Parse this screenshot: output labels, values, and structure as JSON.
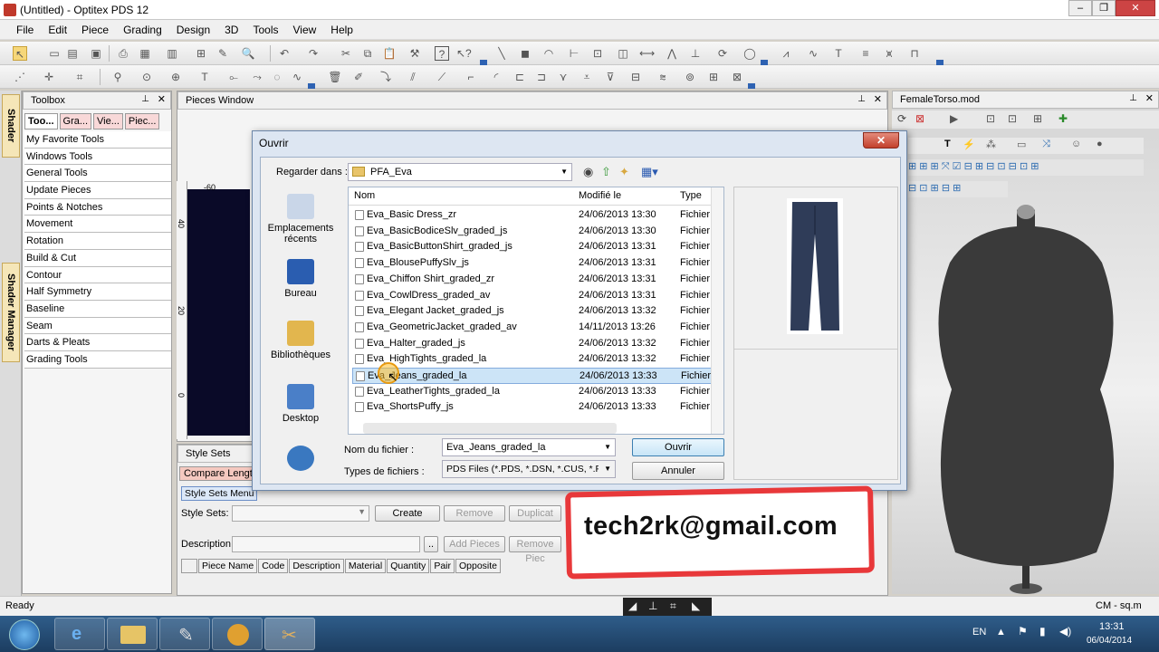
{
  "window": {
    "title": "(Untitled) - Optitex PDS 12",
    "controls": [
      "–",
      "❐",
      "✕"
    ]
  },
  "menu": [
    "File",
    "Edit",
    "Piece",
    "Grading",
    "Design",
    "3D",
    "Tools",
    "View",
    "Help"
  ],
  "side_tabs": [
    "Shader",
    "Shader Manager"
  ],
  "toolbox": {
    "title": "Toolbox",
    "pin": "📌",
    "close": "✕",
    "tabs": [
      "Too...",
      "Gra...",
      "Vie...",
      "Piec..."
    ],
    "items": [
      "My Favorite Tools",
      "Windows Tools",
      "General Tools",
      "Update Pieces",
      "Points & Notches",
      "Movement",
      "Rotation",
      "Build & Cut",
      "Contour",
      "Half Symmetry",
      "Baseline",
      "Seam",
      "Darts & Pleats",
      "Grading Tools"
    ]
  },
  "pieces_window": {
    "title": "Pieces Window",
    "ruler_ticks": [
      "-60",
      "40",
      "20",
      "0"
    ]
  },
  "model_window": {
    "title": "FemaleTorso.mod"
  },
  "style_sets": {
    "title": "Style Sets",
    "compare_tab": "Compare Lengt",
    "menu_button": "Style Sets Menu",
    "style_sets_label": "Style Sets:",
    "description_label": "Description:",
    "create": "Create",
    "remove": "Remove",
    "duplicate": "Duplicat",
    "add_pieces": "Add Pieces",
    "remove_pieces": "Remove Piec",
    "columns": [
      "Piece Name",
      "Code",
      "Description",
      "Material",
      "Quantity",
      "Pair",
      "Opposite"
    ]
  },
  "dialog": {
    "title": "Ouvrir",
    "look_in_label": "Regarder dans :",
    "look_in_value": "PFA_Eva",
    "places": [
      "Emplacements récents",
      "Bureau",
      "Bibliothèques",
      "Desktop"
    ],
    "columns": [
      "Nom",
      "Modifié le",
      "Type"
    ],
    "files": [
      {
        "name": "Eva_Basic Dress_zr",
        "date": "24/06/2013 13:30",
        "type": "Fichier P"
      },
      {
        "name": "Eva_BasicBodiceSlv_graded_js",
        "date": "24/06/2013 13:30",
        "type": "Fichier P"
      },
      {
        "name": "Eva_BasicButtonShirt_graded_js",
        "date": "24/06/2013 13:31",
        "type": "Fichier P"
      },
      {
        "name": "Eva_BlousePuffySlv_js",
        "date": "24/06/2013 13:31",
        "type": "Fichier P"
      },
      {
        "name": "Eva_Chiffon Shirt_graded_zr",
        "date": "24/06/2013 13:31",
        "type": "Fichier P"
      },
      {
        "name": "Eva_CowlDress_graded_av",
        "date": "24/06/2013 13:31",
        "type": "Fichier P"
      },
      {
        "name": "Eva_Elegant Jacket_graded_js",
        "date": "24/06/2013 13:32",
        "type": "Fichier P"
      },
      {
        "name": "Eva_GeometricJacket_graded_av",
        "date": "14/11/2013 13:26",
        "type": "Fichier P"
      },
      {
        "name": "Eva_Halter_graded_js",
        "date": "24/06/2013 13:32",
        "type": "Fichier P"
      },
      {
        "name": "Eva_HighTights_graded_la",
        "date": "24/06/2013 13:32",
        "type": "Fichier P"
      },
      {
        "name": "Eva_Jeans_graded_la",
        "date": "24/06/2013 13:33",
        "type": "Fichier P"
      },
      {
        "name": "Eva_LeatherTights_graded_la",
        "date": "24/06/2013 13:33",
        "type": "Fichier P"
      },
      {
        "name": "Eva_ShortsPuffy_js",
        "date": "24/06/2013 13:33",
        "type": "Fichier P"
      }
    ],
    "selected_index": 10,
    "filename_label": "Nom du fichier :",
    "filename_value": "Eva_Jeans_graded_la",
    "filetype_label": "Types de fichiers :",
    "filetype_value": "PDS Files (*.PDS, *.DSN, *.CUS, *.PDI",
    "open_button": "Ouvrir",
    "cancel_button": "Annuler"
  },
  "overlay": {
    "email": "tech2rk@gmail.com",
    "box_color": "#e8383a"
  },
  "status": {
    "left": "Ready",
    "units": "CM - sq.m"
  },
  "taskbar": {
    "language": "EN",
    "time": "13:31",
    "date": "06/04/2014"
  }
}
